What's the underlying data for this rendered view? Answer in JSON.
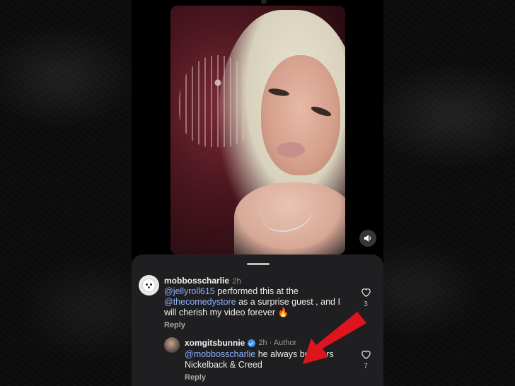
{
  "comments": [
    {
      "username": "mobbosscharlie",
      "time": "2h",
      "mention1": "@jellyroll615",
      "text1": " performed this at the ",
      "mention2": "@thecomedystore",
      "text2": " as a surprise guest , and I will cherish my video forever 🔥",
      "reply_label": "Reply",
      "likes": "3"
    },
    {
      "username": "xomgitsbunnie",
      "time": "2h · Author",
      "mention1": "@mobbosscharlie",
      "text1": " he always butchers Nickelback & Creed",
      "reply_label": "Reply",
      "likes": "7"
    }
  ],
  "icons": {
    "volume": "speaker-icon",
    "like": "heart-icon",
    "verified": "verified-badge-icon",
    "arrow": "red-arrow-annotation"
  },
  "colors": {
    "mention": "#8db0ff",
    "sheet": "#1f1f21",
    "arrow": "#e0141e",
    "verified": "#3897f0"
  }
}
